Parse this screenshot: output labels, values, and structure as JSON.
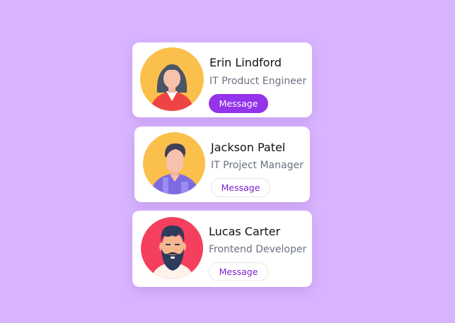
{
  "colors": {
    "background": "#d8b4fe",
    "accent": "#9333ea",
    "name_text": "#111111",
    "role_text": "#6b7280"
  },
  "cards": [
    {
      "name": "Erin Lindford",
      "role": "IT Product Engineer",
      "button_label": "Message",
      "button_style": "filled",
      "avatar_icon": "female-avatar-icon"
    },
    {
      "name": "Jackson Patel",
      "role": "IT Project Manager",
      "button_label": "Message",
      "button_style": "outline",
      "avatar_icon": "male-avatar-icon"
    },
    {
      "name": "Lucas Carter",
      "role": "Frontend Developer",
      "button_label": "Message",
      "button_style": "outline",
      "avatar_icon": "bearded-male-avatar-icon"
    }
  ]
}
